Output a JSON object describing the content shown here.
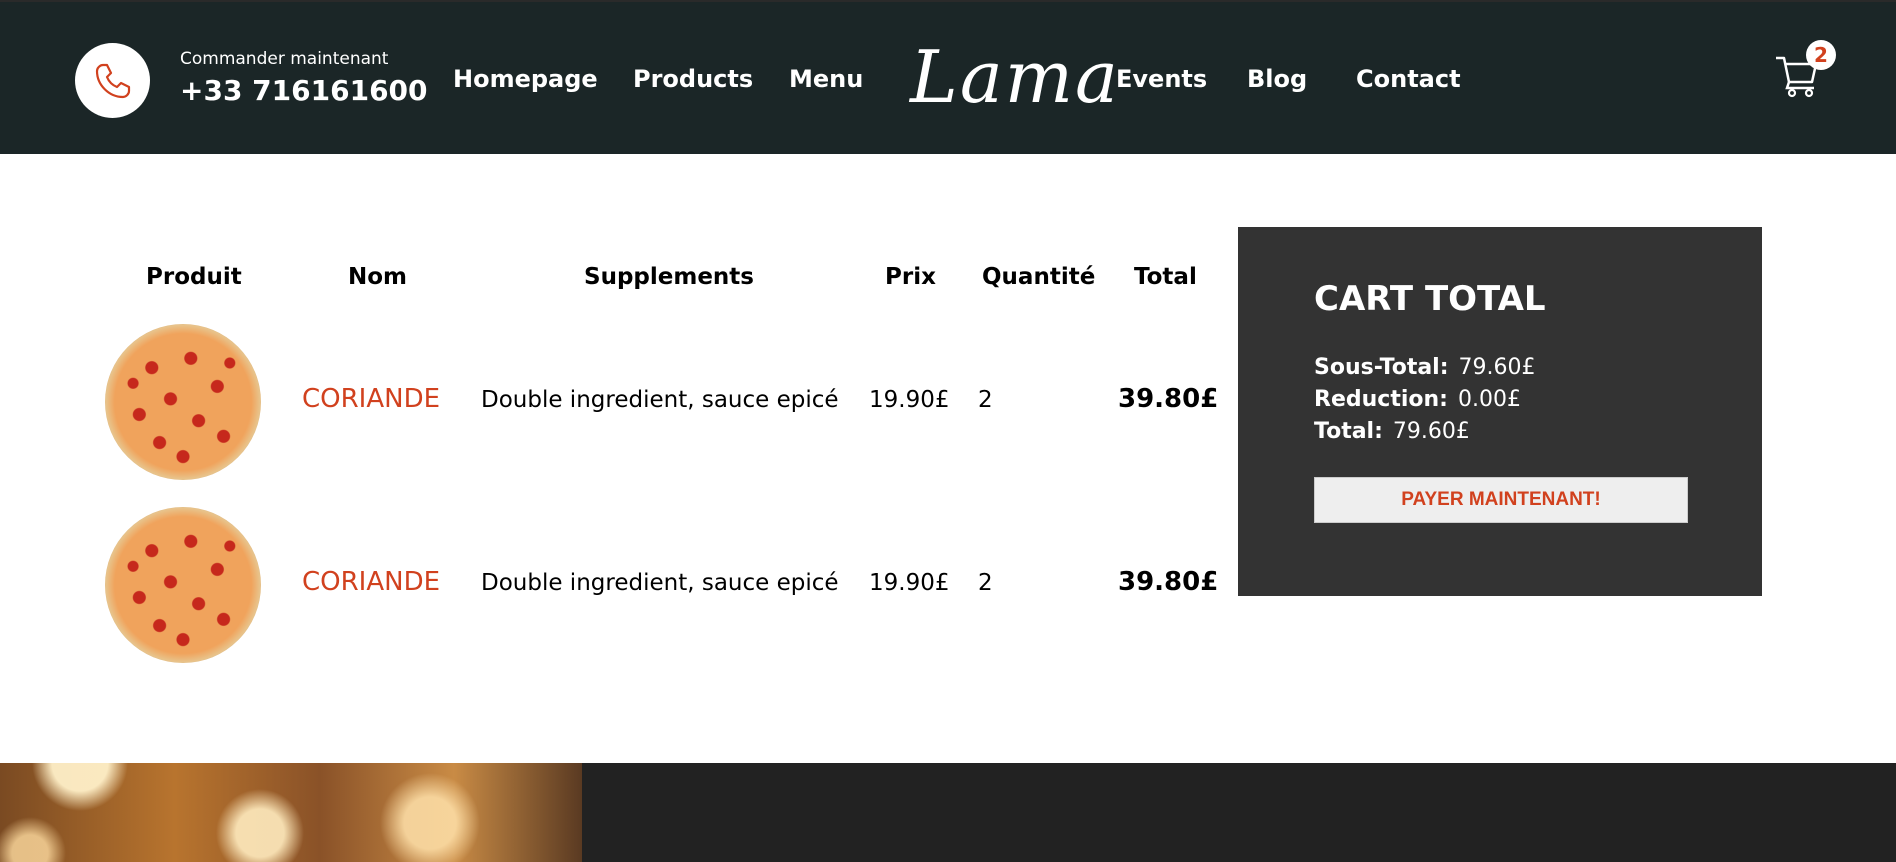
{
  "header": {
    "order_label": "Commander maintenant",
    "phone": "+33 716161600",
    "logo": "Lama",
    "nav": [
      "Homepage",
      "Products",
      "Menu",
      "Events",
      "Blog",
      "Contact"
    ],
    "cart_count": "2"
  },
  "table": {
    "headers": [
      "Produit",
      "Nom",
      "Supplements",
      "Prix",
      "Quantité",
      "Total"
    ],
    "rows": [
      {
        "name": "CORIANDE",
        "supplements": "Double ingredient, sauce epicé",
        "price": "19.90£",
        "quantity": "2",
        "total": "39.80£"
      },
      {
        "name": "CORIANDE",
        "supplements": "Double ingredient, sauce epicé",
        "price": "19.90£",
        "quantity": "2",
        "total": "39.80£"
      }
    ]
  },
  "cart_total": {
    "title": "CART TOTAL",
    "subtotal_label": "Sous-Total:",
    "subtotal_value": "79.60£",
    "discount_label": "Reduction:",
    "discount_value": "0.00£",
    "total_label": "Total:",
    "total_value": "79.60£",
    "pay_button": "PAYER MAINTENANT!"
  },
  "colors": {
    "header_bg": "#1b2627",
    "accent": "#d1411e",
    "total_box_bg": "#333333",
    "footer_bg": "#222222"
  },
  "icons": {
    "phone": "phone-icon",
    "cart": "cart-icon",
    "product": "pizza-image"
  }
}
